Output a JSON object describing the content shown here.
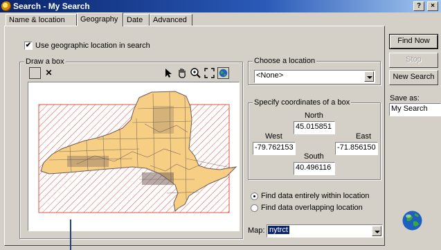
{
  "window": {
    "title": "Search - My Search",
    "help_label": "?",
    "close_label": "×"
  },
  "tabs": [
    {
      "label": "Name & location"
    },
    {
      "label": "Geography"
    },
    {
      "label": "Date"
    },
    {
      "label": "Advanced"
    }
  ],
  "active_tab": "Geography",
  "geo_checkbox": {
    "label": "Use geographic location in search",
    "checked": true,
    "mark": "✔"
  },
  "draw_box": {
    "group_label": "Draw a box",
    "tools": [
      "rectangle-icon",
      "clear-x-icon",
      "select-arrow-icon",
      "pan-hand-icon",
      "zoom-in-icon",
      "full-extent-icon",
      "globe-icon"
    ],
    "clear_glyph": "✕",
    "map_name": "New York State",
    "box_color": "#e0503c",
    "land_color": "#f7cf84"
  },
  "location": {
    "group_label": "Choose a location",
    "selected": "<None>"
  },
  "coords": {
    "group_label": "Specify coordinates of a box",
    "north_label": "North",
    "north": "45.015851",
    "west_label": "West",
    "west": "-79.762153",
    "east_label": "East",
    "east": "-71.856150",
    "south_label": "South",
    "south": "40.496116"
  },
  "find_mode": {
    "options": [
      "Find data entirely within location",
      "Find data overlapping location"
    ],
    "selected_index": 0
  },
  "map_select": {
    "label": "Map:",
    "value": "nytrct"
  },
  "actions": {
    "find_now": "Find Now",
    "stop": "Stop",
    "new_search": "New Search"
  },
  "save_as": {
    "label": "Save as:",
    "value": "My Search"
  },
  "colors": {
    "title_bar": "#0a246a",
    "dialog_face": "#d4d0c8",
    "selection": "#0a246a"
  }
}
